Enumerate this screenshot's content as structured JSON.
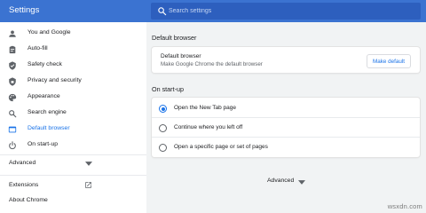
{
  "header": {
    "title": "Settings",
    "search_placeholder": "Search settings"
  },
  "sidebar": {
    "items": [
      {
        "label": "You and Google",
        "icon": "person-icon"
      },
      {
        "label": "Auto-fill",
        "icon": "clipboard-icon"
      },
      {
        "label": "Safety check",
        "icon": "shield-icon"
      },
      {
        "label": "Privacy and security",
        "icon": "shield-lock-icon"
      },
      {
        "label": "Appearance",
        "icon": "palette-icon"
      },
      {
        "label": "Search engine",
        "icon": "search-icon"
      },
      {
        "label": "Default browser",
        "icon": "browser-icon",
        "active": true
      },
      {
        "label": "On start-up",
        "icon": "power-icon"
      }
    ],
    "advanced_label": "Advanced",
    "extensions_label": "Extensions",
    "about_label": "About Chrome"
  },
  "default_browser": {
    "heading": "Default browser",
    "title": "Default browser",
    "subtitle": "Make Google Chrome the default browser",
    "button_label": "Make default"
  },
  "startup": {
    "heading": "On start-up",
    "selected_option": "Open the New Tab page",
    "options": [
      "Open the New Tab page",
      "Continue where you left off",
      "Open a specific page or set of pages"
    ]
  },
  "footer": {
    "advanced_label": "Advanced"
  },
  "watermark": "wsxdn.com",
  "colors": {
    "header_blue": "#3b73d1",
    "accent": "#1a73e8"
  }
}
